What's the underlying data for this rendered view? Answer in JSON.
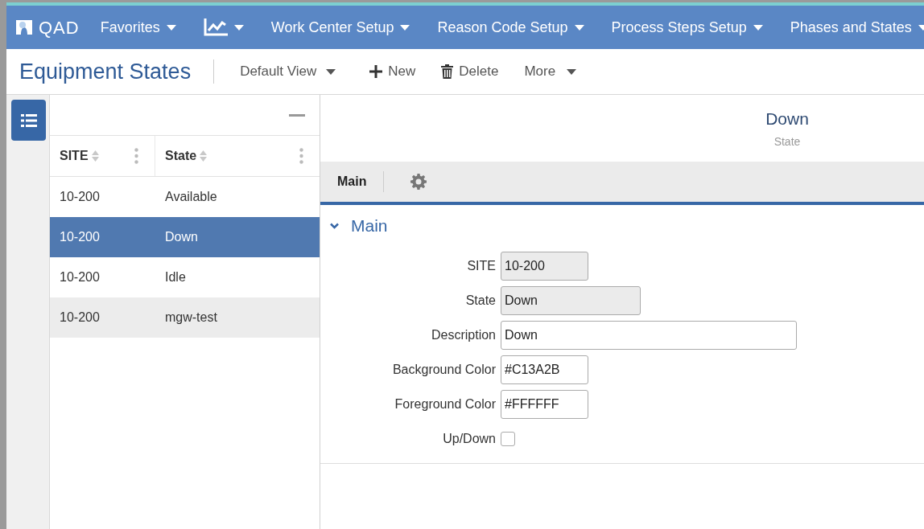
{
  "nav": {
    "logo": "QAD",
    "items": [
      {
        "kind": "text",
        "label": "Favorites"
      },
      {
        "kind": "chart-icon"
      },
      {
        "kind": "text",
        "label": "Work Center Setup"
      },
      {
        "kind": "text",
        "label": "Reason Code Setup"
      },
      {
        "kind": "text",
        "label": "Process Steps Setup"
      },
      {
        "kind": "text",
        "label": "Phases and States"
      }
    ]
  },
  "toolbar": {
    "title": "Equipment States",
    "view": "Default View",
    "actions": [
      {
        "kind": "new",
        "label": "New"
      },
      {
        "kind": "delete",
        "label": "Delete"
      },
      {
        "kind": "more",
        "label": "More"
      }
    ]
  },
  "grid": {
    "columns": [
      "SITE",
      "State"
    ],
    "rows": [
      {
        "cells": [
          "10-200",
          "Available"
        ],
        "selected": false,
        "hovered": false
      },
      {
        "cells": [
          "10-200",
          "Down"
        ],
        "selected": true,
        "hovered": false
      },
      {
        "cells": [
          "10-200",
          "Idle"
        ],
        "selected": false,
        "hovered": false
      },
      {
        "cells": [
          "10-200",
          "mgw-test"
        ],
        "selected": false,
        "hovered": true
      }
    ]
  },
  "detail": {
    "title": "Down",
    "subtitle": "State",
    "tabs": [
      {
        "label": "Main",
        "selected": true
      }
    ],
    "section": {
      "title": "Main",
      "expanded": true
    },
    "fields": [
      {
        "kind": "short-text",
        "label": "SITE",
        "value": "10-200",
        "disabled": true
      },
      {
        "kind": "medium-text",
        "label": "State",
        "value": "Down",
        "disabled": true
      },
      {
        "kind": "long-text",
        "label": "Description",
        "value": "Down",
        "disabled": false
      },
      {
        "kind": "short-text",
        "label": "Background Color",
        "value": "#C13A2B",
        "disabled": false
      },
      {
        "kind": "short-text",
        "label": "Foreground Color",
        "value": "#FFFFFF",
        "disabled": false
      },
      {
        "kind": "checkbox",
        "label": "Up/Down",
        "checked": false
      }
    ]
  }
}
